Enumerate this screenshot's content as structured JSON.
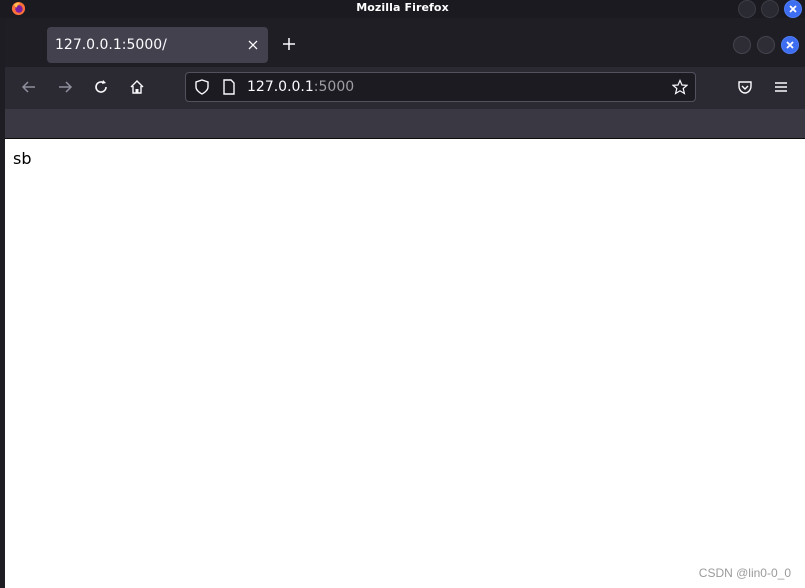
{
  "os": {
    "window_title": "Mozilla Firefox"
  },
  "browser": {
    "tab": {
      "title": "127.0.0.1:5000/"
    },
    "url": {
      "host": "127.0.0.1",
      "port": ":5000"
    }
  },
  "page": {
    "text": "sb"
  },
  "watermark": "CSDN @lin0-0_0",
  "colors": {
    "accent_close": "#3d6df0",
    "toolbar_bg": "#2b2a33",
    "tab_bg": "#42414d"
  },
  "icons": {
    "app": "firefox-icon",
    "back": "arrow-left-icon",
    "forward": "arrow-right-icon",
    "reload": "reload-icon",
    "home": "home-icon",
    "shield": "shield-icon",
    "page": "page-icon",
    "bookmark": "star-icon",
    "pocket": "pocket-icon",
    "menu": "hamburger-menu-icon",
    "tab_close": "close-icon",
    "new_tab": "plus-icon"
  }
}
